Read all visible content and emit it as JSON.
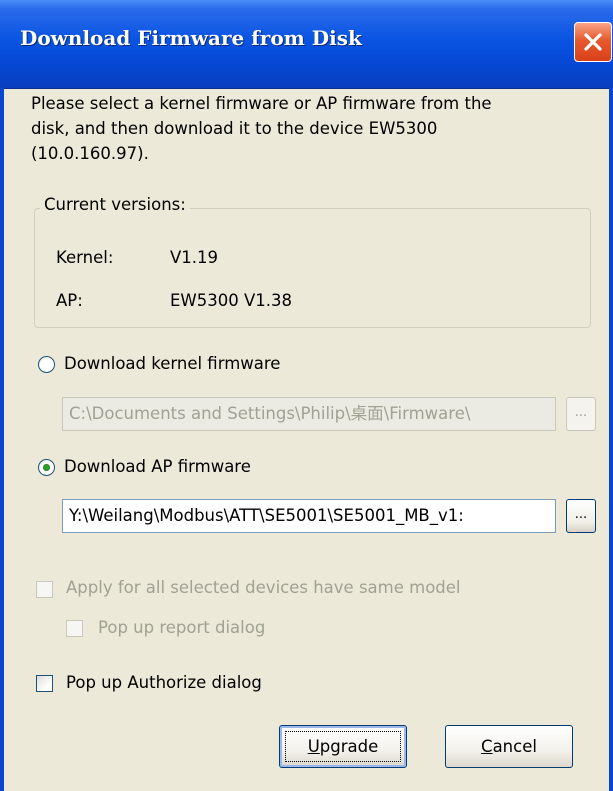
{
  "window": {
    "title": "Download Firmware from Disk",
    "close_icon": "close-x-icon"
  },
  "description": {
    "line1": "Please select a kernel firmware or AP firmware from the",
    "line2": "disk, and then download it to the device EW5300",
    "line3": "(10.0.160.97)."
  },
  "current_versions": {
    "legend": "Current versions:",
    "kernel_label": "Kernel:",
    "kernel_value": "V1.19",
    "ap_label": "AP:",
    "ap_value": "EW5300 V1.38"
  },
  "kernel_option": {
    "label": "Download kernel firmware",
    "selected": false,
    "path": "C:\\Documents and Settings\\Philip\\桌面\\Firmware\\",
    "browse_label": "..."
  },
  "ap_option": {
    "label": "Download AP firmware",
    "selected": true,
    "path": "Y:\\Weilang\\Modbus\\ATT\\SE5001\\SE5001_MB_v1:",
    "browse_label": "..."
  },
  "options": {
    "apply_all_label": "Apply for all selected devices have same model",
    "popup_report_label": "Pop up report dialog",
    "popup_authorize_label": "Pop up Authorize dialog"
  },
  "buttons": {
    "upgrade_prefix": "",
    "upgrade_mnemonic": "U",
    "upgrade_rest": "pgrade",
    "cancel_mnemonic": "C",
    "cancel_rest": "ancel"
  },
  "colors": {
    "titlebar": "#0a54e3",
    "dialog_bg": "#ece9d8",
    "close_button": "#e65a2e",
    "radio_dot": "#2f9a2f"
  }
}
